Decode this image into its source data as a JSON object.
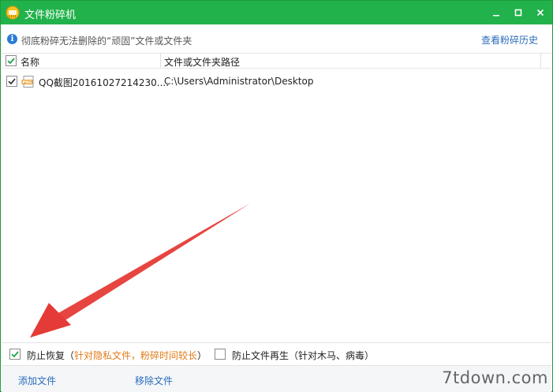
{
  "window": {
    "title": "文件粉碎机",
    "accent": "#21b24b"
  },
  "info": {
    "text": "彻底粉碎无法删除的“顽固”文件或文件夹",
    "history_link": "查看粉碎历史"
  },
  "table": {
    "columns": [
      "名称",
      "文件或文件夹路径"
    ],
    "rows": [
      {
        "name": "QQ截图20161027214230....",
        "path": "C:\\Users\\Administrator\\Desktop",
        "checked": true,
        "icon": "png-file-icon"
      }
    ]
  },
  "options": {
    "prevent_recovery": {
      "label": "防止恢复",
      "note_open": "（",
      "note": "针对隐私文件，粉碎时间较长",
      "note_close": "）",
      "checked": true
    },
    "prevent_regen": {
      "label": "防止文件再生",
      "note_open": "（",
      "note": "针对木马、病毒",
      "note_close": "）",
      "checked": false
    }
  },
  "footer": {
    "add_label": "添加文件",
    "remove_label": "移除文件"
  },
  "watermark": "7tdown.com",
  "colors": {
    "link": "#2b6cbd",
    "note": "#e07b18",
    "arrow": "#e53b36",
    "check": "#1fa34a"
  }
}
